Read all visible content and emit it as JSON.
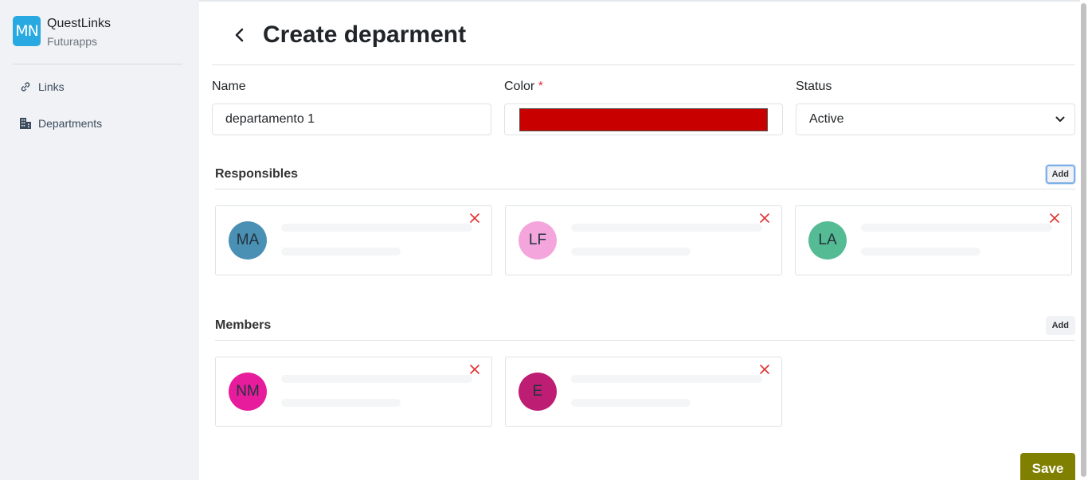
{
  "brand": {
    "logo_text": "MN",
    "name": "QuestLinks",
    "org": "Futurapps"
  },
  "nav": [
    {
      "label": "Links",
      "icon": "link-icon"
    },
    {
      "label": "Departments",
      "icon": "building-icon"
    }
  ],
  "page": {
    "title": "Create deparment"
  },
  "form": {
    "name": {
      "label": "Name",
      "value": "departamento 1"
    },
    "color": {
      "label": "Color",
      "required_mark": "*",
      "value": "#c80000"
    },
    "status": {
      "label": "Status",
      "value": "Active"
    }
  },
  "responsibles": {
    "title": "Responsibles",
    "add_label": "Add",
    "items": [
      {
        "initials": "MA",
        "color": "#4a8fb4"
      },
      {
        "initials": "LF",
        "color": "#f4a6dc"
      },
      {
        "initials": "LA",
        "color": "#55bb94"
      }
    ]
  },
  "members": {
    "title": "Members",
    "add_label": "Add",
    "items": [
      {
        "initials": "NM",
        "color": "#e61c9c"
      },
      {
        "initials": "E",
        "color": "#bd1d72"
      }
    ]
  },
  "actions": {
    "save_label": "Save",
    "save_color": "#7f7f00"
  }
}
